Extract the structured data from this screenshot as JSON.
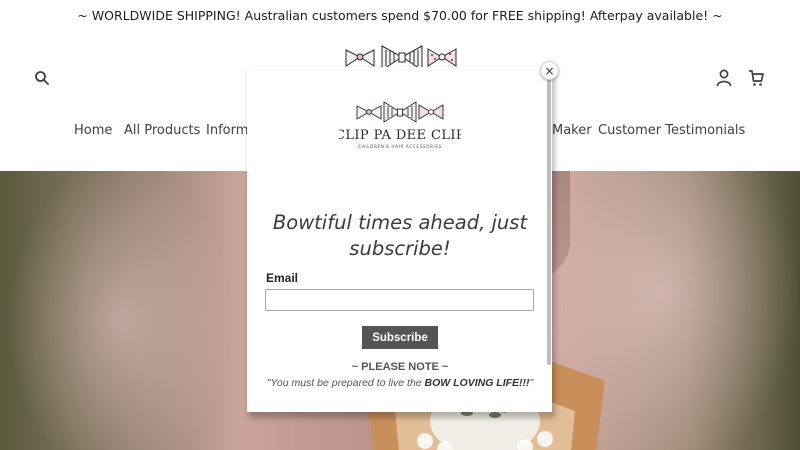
{
  "announcement": {
    "text": "~ WORLDWIDE SHIPPING! Australian customers spend $70.00 for FREE shipping! Afterpay available! ~"
  },
  "header": {
    "icons": [
      "search-icon",
      "account-icon",
      "cart-icon"
    ],
    "logo": "bow-logo"
  },
  "nav": {
    "items": [
      "Home",
      "All Products",
      "Informa",
      "Maker",
      "Customer Testimonials"
    ]
  },
  "popup": {
    "logo_text": "CLIP PA DEE CLIP",
    "logo_subtext": "CHILDREN'S HAIR ACCESSORIES",
    "close_label": "×",
    "heading": "Bowtiful times ahead, just subscribe!",
    "email_label": "Email",
    "email_value": "",
    "email_placeholder": "",
    "subscribe_label": "Subscribe",
    "note_title": "~ PLEASE NOTE ~",
    "note_text_prefix": "\"You must be prepared to live the ",
    "note_text_bold": "BOW LOVING LIFE!!!",
    "note_text_suffix": "\""
  },
  "colors": {
    "button": "#555555",
    "text": "#3d4246"
  }
}
